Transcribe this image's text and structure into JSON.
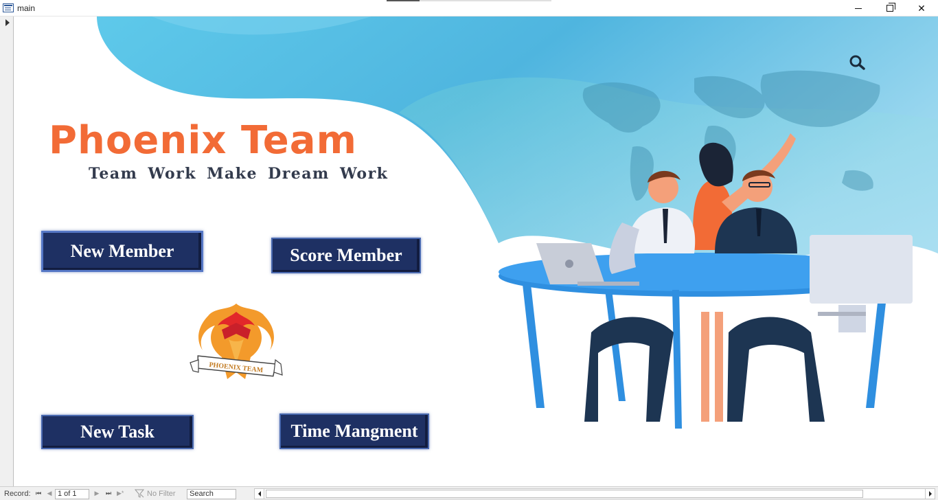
{
  "window": {
    "title": "main",
    "controls": {
      "minimize_icon": "minimize-icon",
      "restore_icon": "restore-icon",
      "close_icon": "close-icon",
      "close_glyph": "✕"
    }
  },
  "form": {
    "brand": {
      "title": "Phoenix Team",
      "tagline": "Team Work Make Dream Work",
      "title_color": "#f26b36",
      "tagline_color": "#333b4d"
    },
    "logo_text": "PHOENIX TEAM",
    "buttons": [
      {
        "label": "New Member"
      },
      {
        "label": "Score Member"
      },
      {
        "label": "New Task"
      },
      {
        "label": "Time Mangment"
      }
    ],
    "button_color": "#1e3063",
    "search_icon": "search-icon"
  },
  "navigation": {
    "record_label": "Record:",
    "record_value": "1 of 1",
    "filter_label": "No Filter",
    "search_value": "Search",
    "glyphs": {
      "first": "⏮",
      "prev": "◀",
      "next": "▶",
      "last": "⏭",
      "new": "▶*"
    }
  }
}
